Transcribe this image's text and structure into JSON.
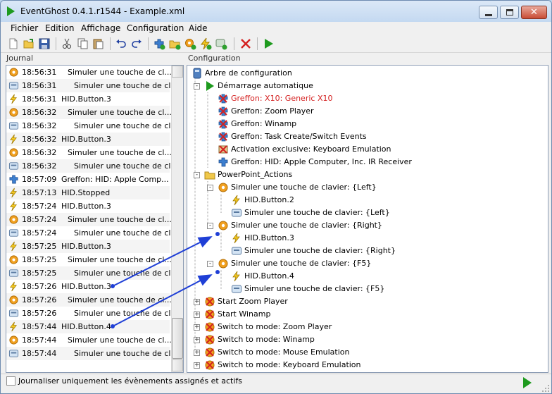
{
  "window": {
    "title": "EventGhost 0.4.1.r1544 - Example.xml",
    "close_glyph": "✕"
  },
  "menu": [
    "Fichier",
    "Edition",
    "Affichage",
    "Configuration",
    "Aide"
  ],
  "toolbar": [
    "new-file-icon",
    "open-folder-icon",
    "save-icon",
    "cut-icon",
    "copy-icon",
    "paste-icon",
    "undo-icon",
    "redo-icon",
    "add-plugin-icon",
    "add-folder-icon",
    "add-macro-icon",
    "add-event-icon",
    "add-action-icon",
    "delete-icon",
    "execute-icon"
  ],
  "journal": {
    "header": "Journal",
    "rows": [
      {
        "icon": "action",
        "time": "18:56:31",
        "msg": "Simuler une touche de cl..."
      },
      {
        "icon": "keyboard",
        "time": "18:56:31",
        "msg": "Simuler une touche de cl..."
      },
      {
        "icon": "event",
        "time": "18:56:31",
        "msg": "HID.Button.3"
      },
      {
        "icon": "action",
        "time": "18:56:32",
        "msg": "Simuler une touche de cl..."
      },
      {
        "icon": "keyboard",
        "time": "18:56:32",
        "msg": "Simuler une touche de cl..."
      },
      {
        "icon": "event",
        "time": "18:56:32",
        "msg": "HID.Button.3"
      },
      {
        "icon": "action",
        "time": "18:56:32",
        "msg": "Simuler une touche de cl..."
      },
      {
        "icon": "keyboard",
        "time": "18:56:32",
        "msg": "Simuler une touche de cl..."
      },
      {
        "icon": "plugin",
        "time": "18:57:09",
        "msg": "Greffon: HID: Apple Comp..."
      },
      {
        "icon": "event",
        "time": "18:57:13",
        "msg": "HID.Stopped"
      },
      {
        "icon": "event",
        "time": "18:57:24",
        "msg": "HID.Button.3"
      },
      {
        "icon": "action",
        "time": "18:57:24",
        "msg": "Simuler une touche de cl..."
      },
      {
        "icon": "keyboard",
        "time": "18:57:24",
        "msg": "Simuler une touche de cl..."
      },
      {
        "icon": "event",
        "time": "18:57:25",
        "msg": "HID.Button.3"
      },
      {
        "icon": "action",
        "time": "18:57:25",
        "msg": "Simuler une touche de cl..."
      },
      {
        "icon": "keyboard",
        "time": "18:57:25",
        "msg": "Simuler une touche de cl..."
      },
      {
        "icon": "event",
        "time": "18:57:26",
        "msg": "HID.Button.3"
      },
      {
        "icon": "action",
        "time": "18:57:26",
        "msg": "Simuler une touche de cl..."
      },
      {
        "icon": "keyboard",
        "time": "18:57:26",
        "msg": "Simuler une touche de cl..."
      },
      {
        "icon": "event",
        "time": "18:57:44",
        "msg": "HID.Button.4"
      },
      {
        "icon": "action",
        "time": "18:57:44",
        "msg": "Simuler une touche de cl..."
      },
      {
        "icon": "keyboard",
        "time": "18:57:44",
        "msg": "Simuler une touche de cl..."
      }
    ]
  },
  "config": {
    "header": "Configuration",
    "tree": [
      {
        "level": 0,
        "icon": "root",
        "label": "Arbre de configuration"
      },
      {
        "level": 1,
        "icon": "autostart",
        "label": "Démarrage automatique",
        "toggle": "-"
      },
      {
        "level": 2,
        "icon": "plugin-disabled",
        "label": "Greffon: X10: Generic X10",
        "red": true
      },
      {
        "level": 2,
        "icon": "plugin-disabled",
        "label": "Greffon: Zoom Player"
      },
      {
        "level": 2,
        "icon": "plugin-disabled",
        "label": "Greffon: Winamp"
      },
      {
        "level": 2,
        "icon": "plugin-disabled",
        "label": "Greffon: Task Create/Switch Events"
      },
      {
        "level": 2,
        "icon": "exclusive",
        "label": "Activation exclusive: Keyboard Emulation"
      },
      {
        "level": 2,
        "icon": "plugin",
        "label": "Greffon: HID: Apple Computer, Inc. IR Receiver"
      },
      {
        "level": 1,
        "icon": "folder",
        "label": "PowerPoint_Actions",
        "toggle": "-"
      },
      {
        "level": 2,
        "icon": "macro",
        "label": "Simuler une touche de clavier: {Left}",
        "toggle": "-"
      },
      {
        "level": 3,
        "icon": "event",
        "label": "HID.Button.2"
      },
      {
        "level": 3,
        "icon": "keyboard",
        "label": "Simuler une touche de clavier: {Left}"
      },
      {
        "level": 2,
        "icon": "macro",
        "label": "Simuler une touche de clavier: {Right}",
        "toggle": "-"
      },
      {
        "level": 3,
        "icon": "event",
        "label": "HID.Button.3"
      },
      {
        "level": 3,
        "icon": "keyboard",
        "label": "Simuler une touche de clavier: {Right}"
      },
      {
        "level": 2,
        "icon": "macro",
        "label": "Simuler une touche de clavier: {F5}",
        "toggle": "-"
      },
      {
        "level": 3,
        "icon": "event",
        "label": "HID.Button.4"
      },
      {
        "level": 3,
        "icon": "keyboard",
        "label": "Simuler une touche de clavier: {F5}"
      },
      {
        "level": 1,
        "icon": "exclusive-macro",
        "label": "Start Zoom Player",
        "toggle": "+"
      },
      {
        "level": 1,
        "icon": "exclusive-macro",
        "label": "Start Winamp",
        "toggle": "+"
      },
      {
        "level": 1,
        "icon": "exclusive-macro",
        "label": "Switch to mode: Zoom Player",
        "toggle": "+"
      },
      {
        "level": 1,
        "icon": "exclusive-macro",
        "label": "Switch to mode: Winamp",
        "toggle": "+"
      },
      {
        "level": 1,
        "icon": "exclusive-macro",
        "label": "Switch to mode: Mouse Emulation",
        "toggle": "+"
      },
      {
        "level": 1,
        "icon": "exclusive-macro",
        "label": "Switch to mode: Keyboard Emulation",
        "toggle": "+"
      }
    ]
  },
  "status": {
    "checkbox_label": "Journaliser uniquement les évènements assignés et actifs"
  },
  "colors": {
    "annotation": "#1f3fd6",
    "red_label": "#d42020"
  }
}
